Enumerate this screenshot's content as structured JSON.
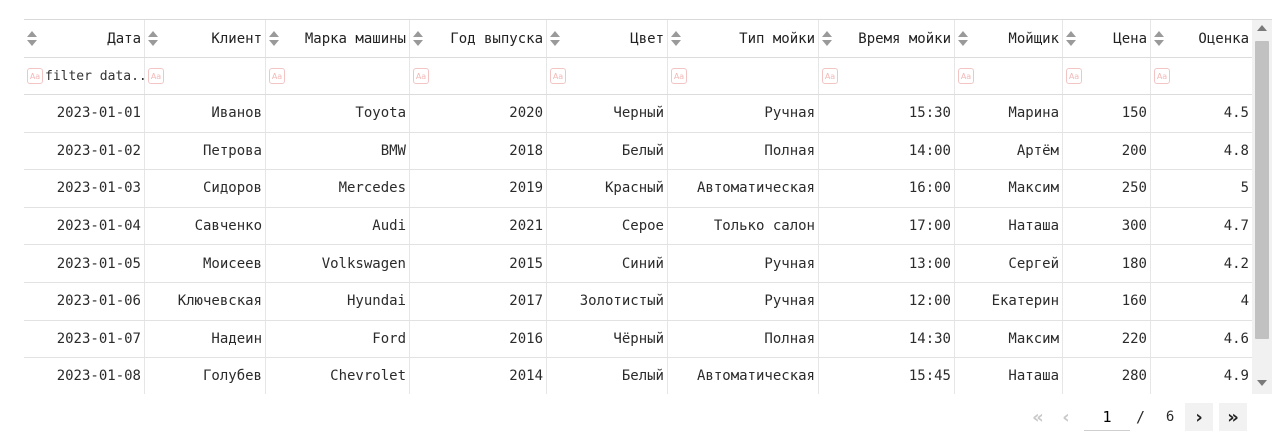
{
  "table": {
    "columns": [
      "Дата",
      "Клиент",
      "Марка машины",
      "Год выпуска",
      "Цвет",
      "Тип мойки",
      "Время мойки",
      "Мойщик",
      "Цена",
      "Оценка"
    ],
    "filter_placeholder": "filter data...",
    "case_icon_label": "Aa",
    "rows": [
      [
        "2023-01-01",
        "Иванов",
        "Toyota",
        "2020",
        "Черный",
        "Ручная",
        "15:30",
        "Марина",
        "150",
        "4.5"
      ],
      [
        "2023-01-02",
        "Петрова",
        "BMW",
        "2018",
        "Белый",
        "Полная",
        "14:00",
        "Артём",
        "200",
        "4.8"
      ],
      [
        "2023-01-03",
        "Сидоров",
        "Mercedes",
        "2019",
        "Красный",
        "Автоматическая",
        "16:00",
        "Максим",
        "250",
        "5"
      ],
      [
        "2023-01-04",
        "Савченко",
        "Audi",
        "2021",
        "Серое",
        "Только салон",
        "17:00",
        "Наташа",
        "300",
        "4.7"
      ],
      [
        "2023-01-05",
        "Моисеев",
        "Volkswagen",
        "2015",
        "Синий",
        "Ручная",
        "13:00",
        "Сергей",
        "180",
        "4.2"
      ],
      [
        "2023-01-06",
        "Ключевская",
        "Hyundai",
        "2017",
        "Золотистый",
        "Ручная",
        "12:00",
        "Екатерин",
        "160",
        "4"
      ],
      [
        "2023-01-07",
        "Надеин",
        "Ford",
        "2016",
        "Чёрный",
        "Полная",
        "14:30",
        "Максим",
        "220",
        "4.6"
      ],
      [
        "2023-01-08",
        "Голубев",
        "Chevrolet",
        "2014",
        "Белый",
        "Автоматическая",
        "15:45",
        "Наташа",
        "280",
        "4.9"
      ]
    ]
  },
  "pagination": {
    "first": "«",
    "prev": "‹",
    "current_page": "1",
    "separator": "/",
    "total_pages": "6",
    "next": "›",
    "last": "»"
  }
}
